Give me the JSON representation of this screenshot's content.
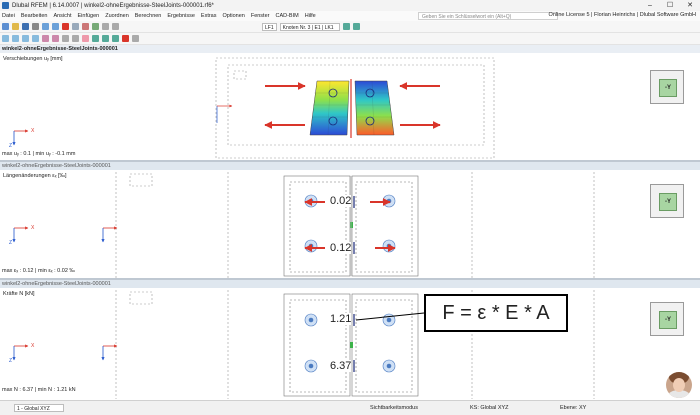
{
  "window": {
    "title": "Dlubal RFEM | 6.14.0007 | winkel2-ohneErgebnisse-SteelJoints-000001.rf6*"
  },
  "menu": {
    "items": [
      "Datei",
      "Bearbeiten",
      "Ansicht",
      "Einfügen",
      "Zuordnen",
      "Berechnen",
      "Ergebnisse",
      "Extras",
      "Optionen",
      "Fenster",
      "CAD-BIM",
      "Hilfe"
    ],
    "search_placeholder": "Geben Sie ein Schlüsselwort ein (Alt+Q)",
    "license": "Online License 5 | Florian Heinrichs | Dlubal Software GmbH"
  },
  "toolbar": {
    "loadcase_label": "LF1",
    "result_selector": "Knoten Nr. 3 | E1 | LK1"
  },
  "tab": {
    "title": "winkel2-ohneErgebnisse-SteelJoints-000001"
  },
  "panes": [
    {
      "title": "winkel2-ohneErgebnisse-SteelJoints-000001",
      "subtitle": "Verschiebungen uᵧ [mm]",
      "minmax": "max uᵧ : 0.1 | min uᵧ : -0.1 mm"
    },
    {
      "title": "winkel2-ohneErgebnisse-SteelJoints-000001",
      "subtitle": "Längenänderungen εₓ [‰]",
      "minmax": "max εₓ : 0.12 | min εₓ : 0.02 ‰",
      "values": [
        "0.02",
        "0.12"
      ]
    },
    {
      "title": "winkel2-ohneErgebnisse-SteelJoints-000001",
      "subtitle": "Kräfte N [kN]",
      "minmax": "max N : 6.37 | min N : 1.21 kN",
      "values": [
        "1.21",
        "6.37"
      ]
    }
  ],
  "viewcube_label": "-Y",
  "axes": {
    "x": "X",
    "z": "Z"
  },
  "formula": "F = ε * E * A",
  "status": {
    "view": "1 - Global XYZ",
    "mode": "Sichtbarkeitsmodus",
    "ks": "KS: Global XYZ",
    "plane": "Ebene: XY"
  },
  "colors": {
    "accent": "#d9352a",
    "pane_title_bg": "#dfe7ef",
    "viewcube_face": "#a8d5a2"
  }
}
